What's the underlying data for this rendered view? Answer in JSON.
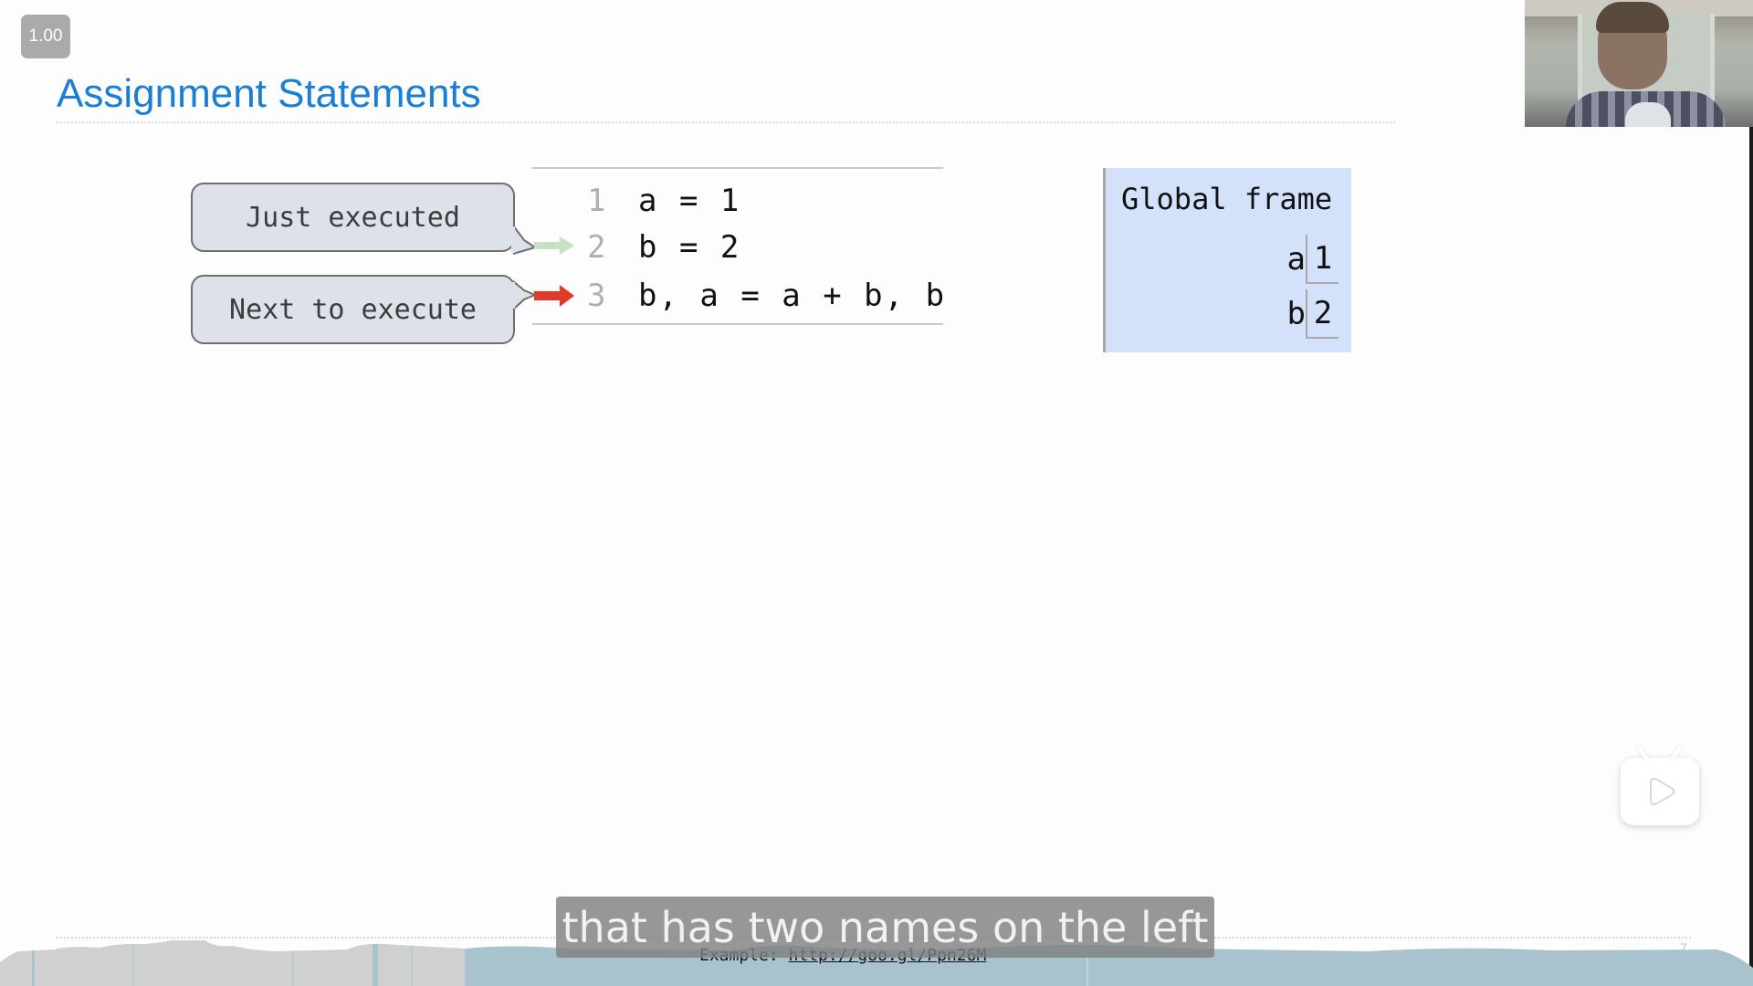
{
  "player": {
    "speed_label": "1.00",
    "subtitle": "that has two names on the left",
    "progress_fraction": 0.265,
    "colors": {
      "played": "#d0d0d0",
      "unplayed": "#a8c3ce",
      "subtitle_bg": "#808080"
    }
  },
  "slide": {
    "title": "Assignment Statements",
    "title_color": "#1a7fd4",
    "page_number": "7",
    "footer": {
      "prefix": "Example: ",
      "link": "http://goo.gl/Ppn26M"
    },
    "callouts": {
      "just_executed": "Just executed",
      "next_to_execute": "Next to execute"
    },
    "arrows": {
      "just_executed_color": "#c6e2c6",
      "next_to_execute_color": "#e23a2a"
    },
    "code": [
      {
        "line_no": "1",
        "text": "a = 1"
      },
      {
        "line_no": "2",
        "text": "b = 2"
      },
      {
        "line_no": "3",
        "text": "b, a = a + b, b"
      }
    ],
    "global_frame": {
      "title": "Global frame",
      "bindings": [
        {
          "name": "a",
          "value": "1"
        },
        {
          "name": "b",
          "value": "2"
        }
      ]
    }
  }
}
